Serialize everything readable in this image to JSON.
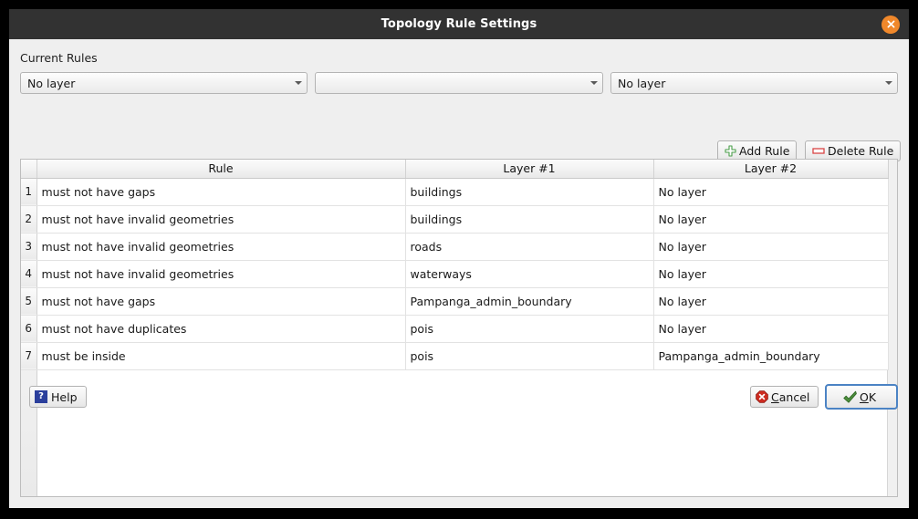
{
  "window": {
    "title": "Topology Rule Settings",
    "close_icon": "close-icon",
    "accent_orange": "#f0882b",
    "titlebar_bg": "#323232",
    "body_bg": "#efefef"
  },
  "section": {
    "label": "Current Rules"
  },
  "selectors": {
    "rule_layer1": {
      "value": "No layer",
      "placeholder": "No layer"
    },
    "rule_type": {
      "value": "",
      "placeholder": ""
    },
    "rule_layer2": {
      "value": "No layer",
      "placeholder": "No layer"
    }
  },
  "toolbar": {
    "add_rule_label": "Add Rule",
    "add_rule_icon": "plus-icon",
    "add_rule_color": "#4a9e4a",
    "delete_rule_label": "Delete Rule",
    "delete_rule_icon": "minus-icon",
    "delete_rule_color": "#d94545"
  },
  "table": {
    "headers": {
      "rownum": "",
      "rule": "Rule",
      "layer1": "Layer #1",
      "layer2": "Layer #2"
    },
    "rows": [
      {
        "num": "1",
        "rule": "must not have gaps",
        "layer1": "buildings",
        "layer2": "No layer"
      },
      {
        "num": "2",
        "rule": "must not have invalid geometries",
        "layer1": "buildings",
        "layer2": "No layer"
      },
      {
        "num": "3",
        "rule": "must not have invalid geometries",
        "layer1": "roads",
        "layer2": "No layer"
      },
      {
        "num": "4",
        "rule": "must not have invalid geometries",
        "layer1": "waterways",
        "layer2": "No layer"
      },
      {
        "num": "5",
        "rule": "must not have gaps",
        "layer1": "Pampanga_admin_boundary",
        "layer2": "No layer"
      },
      {
        "num": "6",
        "rule": "must not have duplicates",
        "layer1": "pois",
        "layer2": "No layer"
      },
      {
        "num": "7",
        "rule": "must be inside",
        "layer1": "pois",
        "layer2": "Pampanga_admin_boundary"
      }
    ]
  },
  "footer": {
    "help_label": "Help",
    "help_icon": "question-icon",
    "cancel_label_pre": "",
    "cancel_mnemonic": "C",
    "cancel_label_post": "ancel",
    "cancel_icon": "cancel-icon",
    "ok_mnemonic": "O",
    "ok_label_post": "K",
    "ok_icon": "check-icon"
  }
}
